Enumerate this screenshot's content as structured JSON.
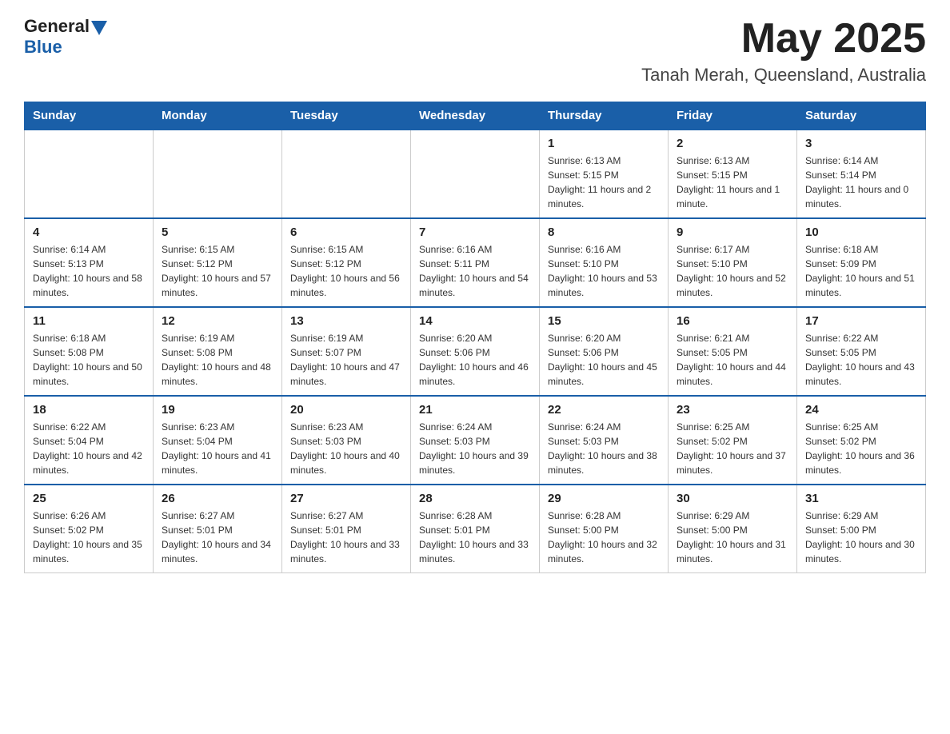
{
  "header": {
    "logo_general": "General",
    "logo_blue": "Blue",
    "month_title": "May 2025",
    "location": "Tanah Merah, Queensland, Australia"
  },
  "days_of_week": [
    "Sunday",
    "Monday",
    "Tuesday",
    "Wednesday",
    "Thursday",
    "Friday",
    "Saturday"
  ],
  "weeks": [
    [
      {
        "day": "",
        "info": ""
      },
      {
        "day": "",
        "info": ""
      },
      {
        "day": "",
        "info": ""
      },
      {
        "day": "",
        "info": ""
      },
      {
        "day": "1",
        "info": "Sunrise: 6:13 AM\nSunset: 5:15 PM\nDaylight: 11 hours and 2 minutes."
      },
      {
        "day": "2",
        "info": "Sunrise: 6:13 AM\nSunset: 5:15 PM\nDaylight: 11 hours and 1 minute."
      },
      {
        "day": "3",
        "info": "Sunrise: 6:14 AM\nSunset: 5:14 PM\nDaylight: 11 hours and 0 minutes."
      }
    ],
    [
      {
        "day": "4",
        "info": "Sunrise: 6:14 AM\nSunset: 5:13 PM\nDaylight: 10 hours and 58 minutes."
      },
      {
        "day": "5",
        "info": "Sunrise: 6:15 AM\nSunset: 5:12 PM\nDaylight: 10 hours and 57 minutes."
      },
      {
        "day": "6",
        "info": "Sunrise: 6:15 AM\nSunset: 5:12 PM\nDaylight: 10 hours and 56 minutes."
      },
      {
        "day": "7",
        "info": "Sunrise: 6:16 AM\nSunset: 5:11 PM\nDaylight: 10 hours and 54 minutes."
      },
      {
        "day": "8",
        "info": "Sunrise: 6:16 AM\nSunset: 5:10 PM\nDaylight: 10 hours and 53 minutes."
      },
      {
        "day": "9",
        "info": "Sunrise: 6:17 AM\nSunset: 5:10 PM\nDaylight: 10 hours and 52 minutes."
      },
      {
        "day": "10",
        "info": "Sunrise: 6:18 AM\nSunset: 5:09 PM\nDaylight: 10 hours and 51 minutes."
      }
    ],
    [
      {
        "day": "11",
        "info": "Sunrise: 6:18 AM\nSunset: 5:08 PM\nDaylight: 10 hours and 50 minutes."
      },
      {
        "day": "12",
        "info": "Sunrise: 6:19 AM\nSunset: 5:08 PM\nDaylight: 10 hours and 48 minutes."
      },
      {
        "day": "13",
        "info": "Sunrise: 6:19 AM\nSunset: 5:07 PM\nDaylight: 10 hours and 47 minutes."
      },
      {
        "day": "14",
        "info": "Sunrise: 6:20 AM\nSunset: 5:06 PM\nDaylight: 10 hours and 46 minutes."
      },
      {
        "day": "15",
        "info": "Sunrise: 6:20 AM\nSunset: 5:06 PM\nDaylight: 10 hours and 45 minutes."
      },
      {
        "day": "16",
        "info": "Sunrise: 6:21 AM\nSunset: 5:05 PM\nDaylight: 10 hours and 44 minutes."
      },
      {
        "day": "17",
        "info": "Sunrise: 6:22 AM\nSunset: 5:05 PM\nDaylight: 10 hours and 43 minutes."
      }
    ],
    [
      {
        "day": "18",
        "info": "Sunrise: 6:22 AM\nSunset: 5:04 PM\nDaylight: 10 hours and 42 minutes."
      },
      {
        "day": "19",
        "info": "Sunrise: 6:23 AM\nSunset: 5:04 PM\nDaylight: 10 hours and 41 minutes."
      },
      {
        "day": "20",
        "info": "Sunrise: 6:23 AM\nSunset: 5:03 PM\nDaylight: 10 hours and 40 minutes."
      },
      {
        "day": "21",
        "info": "Sunrise: 6:24 AM\nSunset: 5:03 PM\nDaylight: 10 hours and 39 minutes."
      },
      {
        "day": "22",
        "info": "Sunrise: 6:24 AM\nSunset: 5:03 PM\nDaylight: 10 hours and 38 minutes."
      },
      {
        "day": "23",
        "info": "Sunrise: 6:25 AM\nSunset: 5:02 PM\nDaylight: 10 hours and 37 minutes."
      },
      {
        "day": "24",
        "info": "Sunrise: 6:25 AM\nSunset: 5:02 PM\nDaylight: 10 hours and 36 minutes."
      }
    ],
    [
      {
        "day": "25",
        "info": "Sunrise: 6:26 AM\nSunset: 5:02 PM\nDaylight: 10 hours and 35 minutes."
      },
      {
        "day": "26",
        "info": "Sunrise: 6:27 AM\nSunset: 5:01 PM\nDaylight: 10 hours and 34 minutes."
      },
      {
        "day": "27",
        "info": "Sunrise: 6:27 AM\nSunset: 5:01 PM\nDaylight: 10 hours and 33 minutes."
      },
      {
        "day": "28",
        "info": "Sunrise: 6:28 AM\nSunset: 5:01 PM\nDaylight: 10 hours and 33 minutes."
      },
      {
        "day": "29",
        "info": "Sunrise: 6:28 AM\nSunset: 5:00 PM\nDaylight: 10 hours and 32 minutes."
      },
      {
        "day": "30",
        "info": "Sunrise: 6:29 AM\nSunset: 5:00 PM\nDaylight: 10 hours and 31 minutes."
      },
      {
        "day": "31",
        "info": "Sunrise: 6:29 AM\nSunset: 5:00 PM\nDaylight: 10 hours and 30 minutes."
      }
    ]
  ]
}
